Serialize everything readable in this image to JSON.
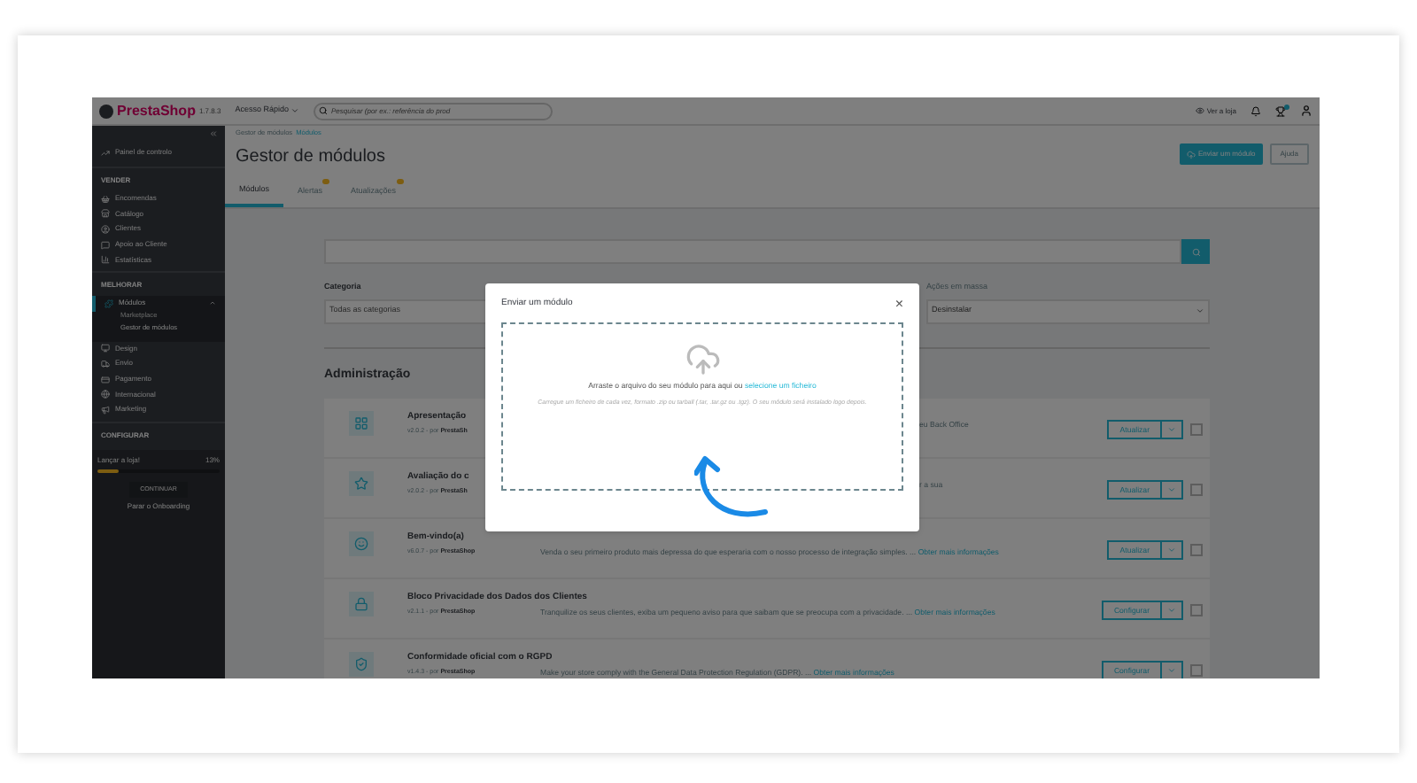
{
  "topbar": {
    "logo": "PrestaShop",
    "version": "1.7.8.3",
    "quick_access": "Acesso Rápido",
    "search": {
      "placeholder": "Pesquisar (por ex.: referência do prod"
    },
    "view_store": "Ver a loja"
  },
  "sidebar": {
    "dashboard": "Painel de controlo",
    "sections": [
      {
        "title": "VENDER",
        "items": [
          {
            "label": "Encomendas",
            "selected": false
          },
          {
            "label": "Catálogo",
            "selected": false
          },
          {
            "label": "Clientes",
            "selected": false
          },
          {
            "label": "Apoio ao Cliente",
            "selected": false
          },
          {
            "label": "Estatísticas",
            "selected": false
          }
        ]
      },
      {
        "title": "MELHORAR",
        "items": [
          {
            "label": "Módulos",
            "selected": true,
            "expanded": true,
            "children": [
              {
                "label": "Marketplace",
                "selected": false
              },
              {
                "label": "Gestor de módulos",
                "selected": true
              }
            ]
          },
          {
            "label": "Design",
            "selected": false
          },
          {
            "label": "Envio",
            "selected": false
          },
          {
            "label": "Pagamento",
            "selected": false
          },
          {
            "label": "Internacional",
            "selected": false
          },
          {
            "label": "Marketing",
            "selected": false
          }
        ]
      },
      {
        "title": "CONFIGURAR"
      }
    ],
    "onboarding": {
      "label": "Lançar a loja!",
      "percent": "13%",
      "level": 0.17,
      "button": "CONTINUAR",
      "link": "Parar o Onboarding"
    }
  },
  "header": {
    "breadcrumb": [
      "Gestor de módulos",
      "Módulos"
    ],
    "title": "Gestor de módulos",
    "buttons": [
      {
        "label": "Enviar um módulo",
        "kind": "primary"
      },
      {
        "label": "Ajuda",
        "kind": "secondary"
      }
    ],
    "tabs": [
      {
        "label": "Módulos",
        "selected": true,
        "badge": false
      },
      {
        "label": "Alertas",
        "selected": false,
        "badge": true
      },
      {
        "label": "Atualizações",
        "selected": false,
        "badge": true
      }
    ]
  },
  "filters": {
    "category_label": "Categoria",
    "category_value": "Todas as categorias",
    "bulk_label": "Ações em massa",
    "bulk_value": "Desinstalar"
  },
  "section_title": "Administração",
  "modules": [
    {
      "kind": "covered",
      "name": "Apresentação",
      "version": "v2.0.2 - por",
      "author": "PrestaSh",
      "description": "eu Back Office",
      "action": "Atualizar",
      "checked": false
    },
    {
      "kind": "covered",
      "name": "Avaliação do c",
      "version": "v2.0.2 - por",
      "author": "PrestaSh",
      "description": "r a sua",
      "action": "Atualizar",
      "checked": false
    },
    {
      "kind": "full",
      "name": "Bem-vindo(a)",
      "version": "v6.0.7 - por",
      "author": "PrestaShop",
      "description": "Venda o seu primeiro produto mais depressa do que esperaria com o nosso processo de integração simples. ...",
      "link": "Obter mais informações",
      "action": "Atualizar",
      "checked": false
    },
    {
      "kind": "full",
      "name": "Bloco Privacidade dos Dados dos Clientes",
      "version": "v2.1.1 - por",
      "author": "PrestaShop",
      "description": "Tranquilize os seus clientes, exiba um pequeno aviso para que saibam que se preocupa com a privacidade. ...",
      "link": "Obter mais informações",
      "action": "Configurar",
      "checked": false
    },
    {
      "kind": "full",
      "name": "Conformidade oficial com o RGPD",
      "version": "v1.4.3 - por",
      "author": "PrestaShop",
      "description": "Make your store comply with the General Data Protection Regulation (GDPR). ...",
      "link": "Obter mais informações",
      "action": "Configurar",
      "checked": false
    }
  ],
  "modal": {
    "title": "Enviar um módulo",
    "close": "×",
    "drop_text": "Arraste o arquivo do seu módulo para aqui ou",
    "drop_link": "selecione um ficheiro",
    "hint": "Carregue um ficheiro de cada vez, formato .zip ou tarball (.tar, .tar.gz ou .tgz). O seu módulo será instalado logo depois."
  }
}
